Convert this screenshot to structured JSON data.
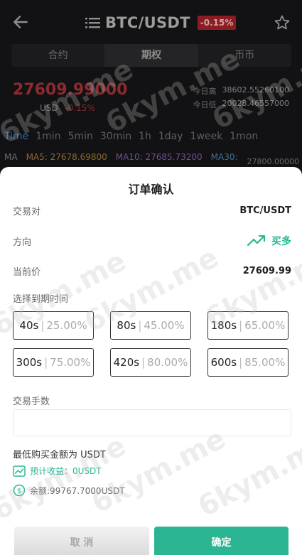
{
  "header": {
    "title": "BTC/USDT",
    "change_badge": "-0.15%"
  },
  "tabs": [
    {
      "label": "合约"
    },
    {
      "label": "期权"
    },
    {
      "label": "币币"
    }
  ],
  "market": {
    "price": "27609.99000",
    "price_sub_currency": "USD",
    "price_sub_change": "-0.15%",
    "stats": [
      {
        "label": "今日高",
        "value": "38602.55260100"
      },
      {
        "label": "今日低",
        "value": "20028.46557000"
      }
    ]
  },
  "timeframes": [
    "Time",
    "1min",
    "5min",
    "30min",
    "1h",
    "1day",
    "1week",
    "1mon"
  ],
  "ma": {
    "label": "MA",
    "ma5": "MA5: 27678.69800",
    "ma10": "MA10: 27685.73200",
    "ma30": "MA30:",
    "axis_value": "27800.00000"
  },
  "order": {
    "title": "订单确认",
    "pair_label": "交易对",
    "pair_value": "BTC/USDT",
    "direction_label": "方向",
    "direction_value": "买多",
    "current_price_label": "当前价",
    "current_price_value": "27609.99",
    "expiry_label": "选择到期时间",
    "options": [
      {
        "time": "40s",
        "rate": "25.00%"
      },
      {
        "time": "80s",
        "rate": "45.00%"
      },
      {
        "time": "180s",
        "rate": "65.00%"
      },
      {
        "time": "300s",
        "rate": "75.00%"
      },
      {
        "time": "420s",
        "rate": "80.00%"
      },
      {
        "time": "600s",
        "rate": "85.00%"
      }
    ],
    "count_label": "交易手数",
    "count_value": "",
    "min_buy": "最低购买金额为 USDT",
    "expected_profit": "预计收益：0USDT",
    "balance": "余额:99767.7000USDT",
    "cancel_label": "取 消",
    "confirm_label": "确定"
  },
  "watermark": "6kym.me",
  "colors": {
    "accent": "#2bb592",
    "down": "#8a1d24",
    "link": "#2c6aa8"
  }
}
